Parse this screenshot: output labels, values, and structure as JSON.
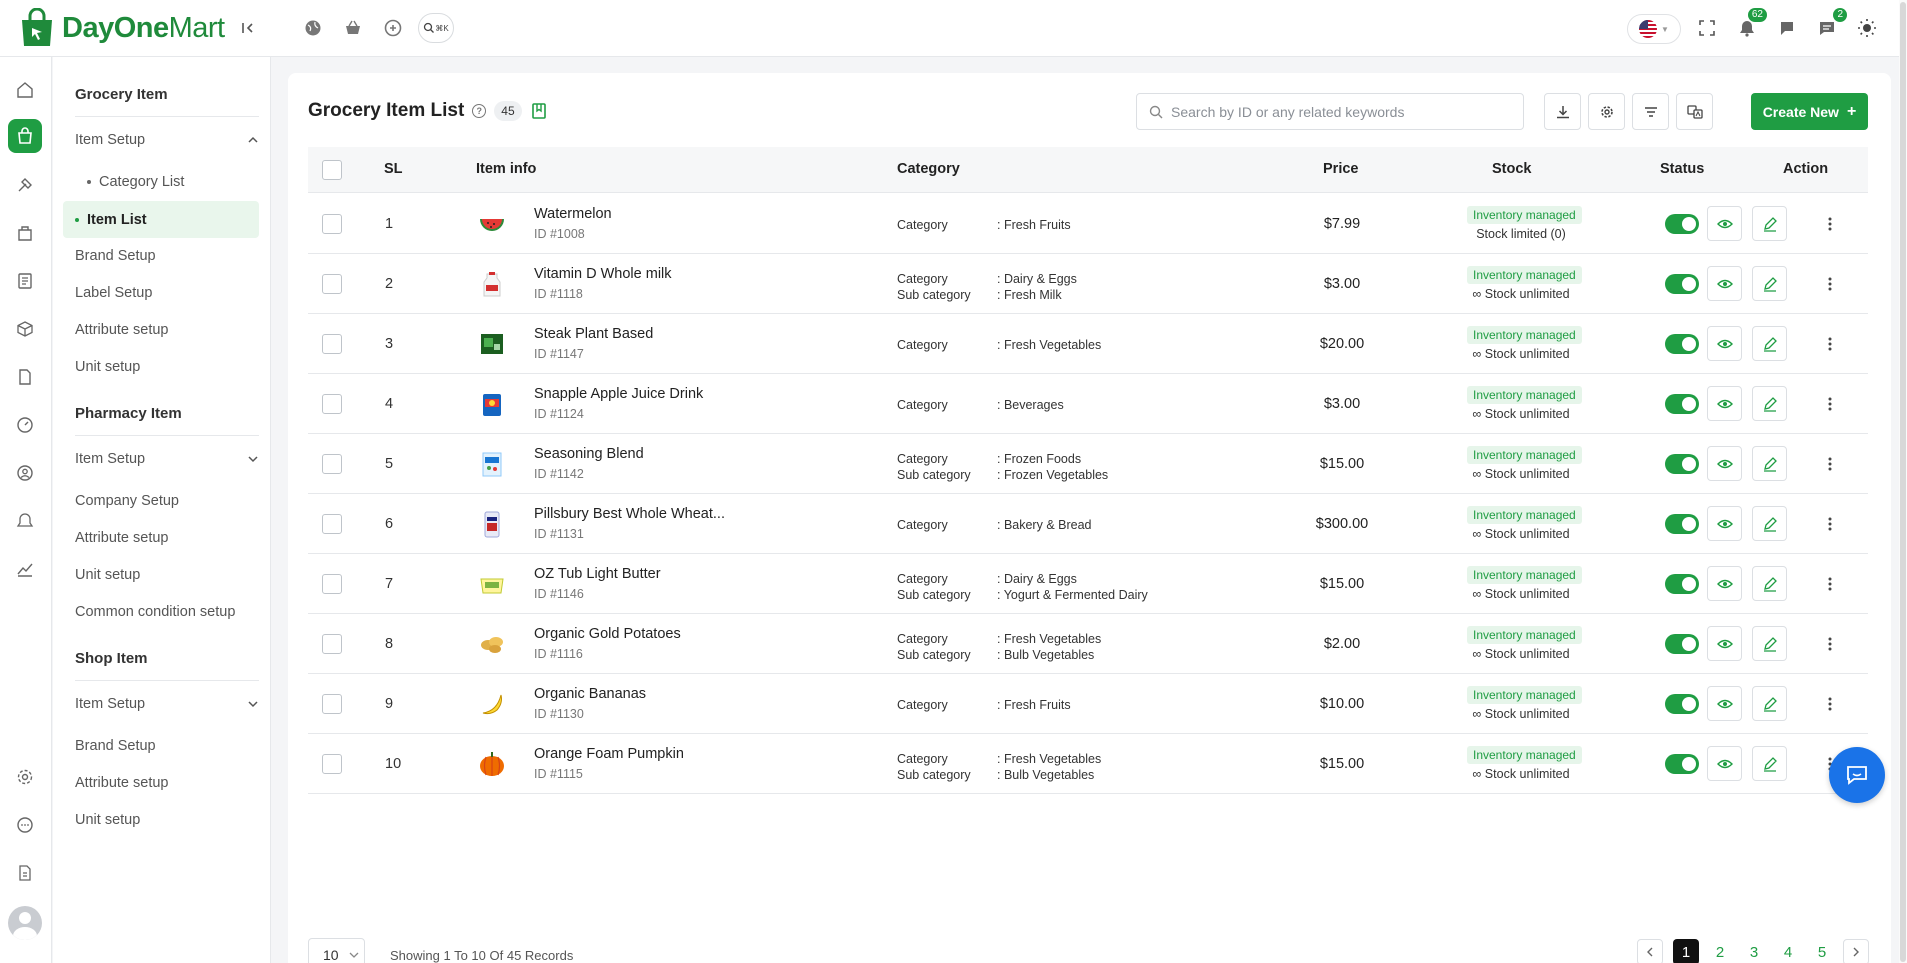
{
  "brand": {
    "name_bold": "DayOne",
    "name_light": "Mart"
  },
  "header": {
    "notifications_count": "62",
    "messages_count": "2"
  },
  "subnav": {
    "sections": [
      {
        "title": "Grocery Item"
      },
      {
        "title": "Pharmacy Item"
      },
      {
        "title": "Shop Item"
      }
    ],
    "grocery": {
      "item_setup": "Item Setup",
      "category_list": "Category List",
      "item_list": "Item List",
      "brand_setup": "Brand Setup",
      "label_setup": "Label Setup",
      "attribute_setup": "Attribute setup",
      "unit_setup": "Unit setup"
    },
    "pharmacy": {
      "item_setup": "Item Setup",
      "company_setup": "Company Setup",
      "attribute_setup": "Attribute setup",
      "unit_setup": "Unit setup",
      "common_condition_setup": "Common condition setup"
    },
    "shop": {
      "item_setup": "Item Setup",
      "brand_setup": "Brand Setup",
      "attribute_setup": "Attribute setup",
      "unit_setup": "Unit setup"
    }
  },
  "main": {
    "title": "Grocery Item List",
    "total_count": "45",
    "search_placeholder": "Search by ID or any related keywords",
    "create_label": "Create New",
    "columns": {
      "sl": "SL",
      "item_info": "Item info",
      "category": "Category",
      "price": "Price",
      "stock": "Stock",
      "status": "Status",
      "action": "Action"
    },
    "inventory_label": "Inventory managed",
    "category_label": "Category",
    "subcategory_label": "Sub category",
    "rows": [
      {
        "sl": "1",
        "name": "Watermelon",
        "id": "ID #1008",
        "icon": "watermelon",
        "category": ": Fresh Fruits",
        "subcategory": "",
        "price": "$7.99",
        "stock": "Stock limited (0)"
      },
      {
        "sl": "2",
        "name": "Vitamin D Whole milk",
        "id": "ID #1118",
        "icon": "milk",
        "category": ": Dairy & Eggs",
        "subcategory": ": Fresh Milk",
        "price": "$3.00",
        "stock": "∞ Stock unlimited"
      },
      {
        "sl": "3",
        "name": "Steak Plant Based",
        "id": "ID #1147",
        "icon": "steak",
        "category": ": Fresh Vegetables",
        "subcategory": "",
        "price": "$20.00",
        "stock": "∞ Stock unlimited"
      },
      {
        "sl": "4",
        "name": "Snapple Apple Juice Drink",
        "id": "ID #1124",
        "icon": "juice",
        "category": ": Beverages",
        "subcategory": "",
        "price": "$3.00",
        "stock": "∞ Stock unlimited"
      },
      {
        "sl": "5",
        "name": "Seasoning Blend",
        "id": "ID #1142",
        "icon": "seasoning",
        "category": ": Frozen Foods",
        "subcategory": ": Frozen Vegetables",
        "price": "$15.00",
        "stock": "∞ Stock unlimited"
      },
      {
        "sl": "6",
        "name": "Pillsbury Best Whole Wheat...",
        "id": "ID #1131",
        "icon": "flour",
        "category": ": Bakery & Bread",
        "subcategory": "",
        "price": "$300.00",
        "stock": "∞ Stock unlimited"
      },
      {
        "sl": "7",
        "name": "OZ Tub Light Butter",
        "id": "ID #1146",
        "icon": "butter",
        "category": ": Dairy & Eggs",
        "subcategory": ": Yogurt & Fermented Dairy",
        "price": "$15.00",
        "stock": "∞ Stock unlimited"
      },
      {
        "sl": "8",
        "name": "Organic Gold Potatoes",
        "id": "ID #1116",
        "icon": "potato",
        "category": ": Fresh Vegetables",
        "subcategory": ": Bulb Vegetables",
        "price": "$2.00",
        "stock": "∞ Stock unlimited"
      },
      {
        "sl": "9",
        "name": "Organic Bananas",
        "id": "ID #1130",
        "icon": "banana",
        "category": ": Fresh Fruits",
        "subcategory": "",
        "price": "$10.00",
        "stock": "∞ Stock unlimited"
      },
      {
        "sl": "10",
        "name": "Orange Foam Pumpkin",
        "id": "ID #1115",
        "icon": "pumpkin",
        "category": ": Fresh Vegetables",
        "subcategory": ": Bulb Vegetables",
        "price": "$15.00",
        "stock": "∞ Stock unlimited"
      }
    ]
  },
  "footer": {
    "per_page": "10",
    "showing": "Showing 1 To 10 Of 45 Records",
    "pages": [
      "1",
      "2",
      "3",
      "4",
      "5"
    ],
    "current_page": "1"
  },
  "colors": {
    "accent": "#1f9d43",
    "chat": "#1a73e8"
  }
}
